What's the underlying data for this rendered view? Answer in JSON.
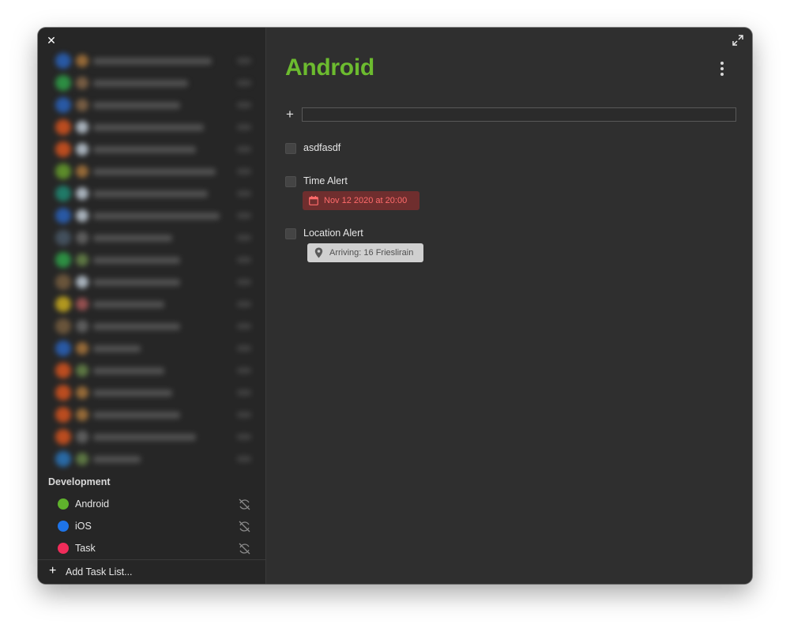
{
  "sidebar": {
    "close_icon": "close-icon",
    "section_title": "Development",
    "lists": [
      {
        "name": "Android",
        "color": "#5fb22c",
        "sync_icon": "sync-off-icon"
      },
      {
        "name": "iOS",
        "color": "#1e74e8",
        "sync_icon": "sync-off-icon"
      },
      {
        "name": "Task",
        "color": "#f02c5a",
        "sync_icon": "sync-off-icon"
      }
    ],
    "add_list_label": "Add Task List..."
  },
  "main": {
    "expand_icon": "expand-icon",
    "title": "Android",
    "title_color": "#6cbb2f",
    "more_icon": "more-vertical-icon",
    "add_task": {
      "icon": "plus-icon",
      "value": "",
      "placeholder": ""
    },
    "tasks": [
      {
        "title": "asdfasdf",
        "checked": false
      },
      {
        "title": "Time Alert",
        "checked": false,
        "alert": {
          "icon": "calendar-icon",
          "text": "Nov 12 2020 at 20:00",
          "color": "#ff6b6b"
        }
      },
      {
        "title": "Location Alert",
        "checked": false,
        "location": {
          "icon": "map-pin-icon",
          "text": "Arriving: 16 Frieslirain"
        }
      }
    ]
  }
}
